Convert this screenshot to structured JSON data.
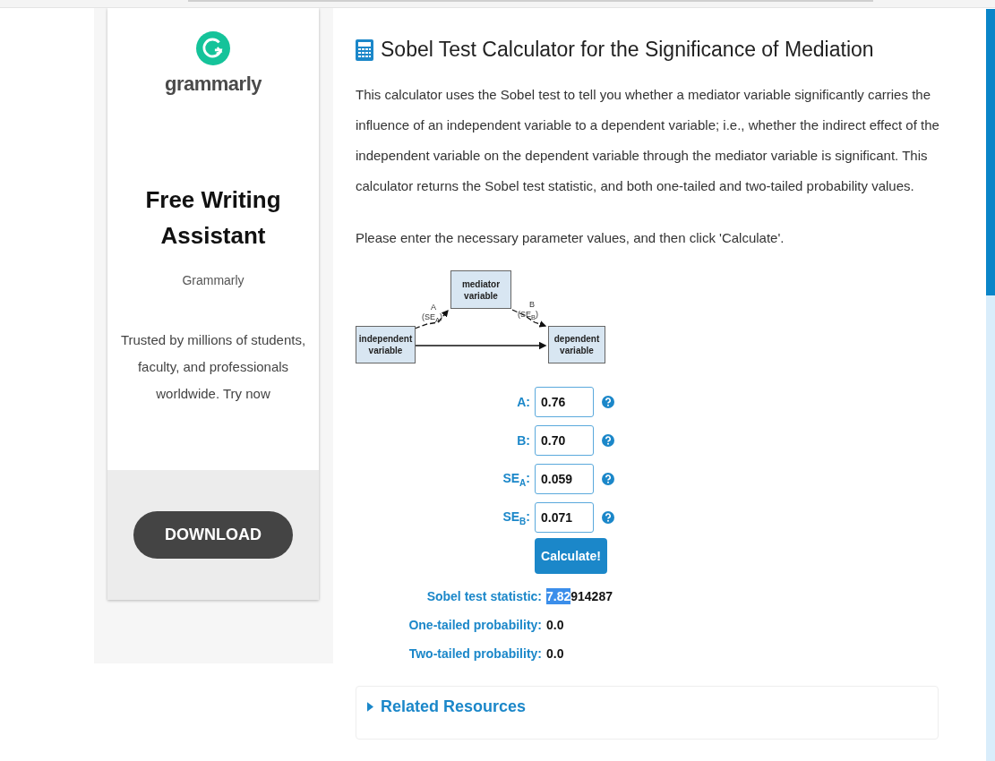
{
  "ad": {
    "logo_word": "grammarly",
    "headline": "Free Writing Assistant",
    "advertiser": "Grammarly",
    "description": "Trusted by millions of students, faculty, and professionals worldwide. Try now",
    "button": "DOWNLOAD"
  },
  "title": "Sobel Test Calculator for the Significance of Mediation",
  "intro": "This calculator uses the Sobel test to tell you whether a mediator variable significantly carries the influence of an independent variable to a dependent variable; i.e., whether the indirect effect of the independent variable on the dependent variable through the mediator variable is significant. This calculator returns the Sobel test statistic, and both one-tailed and two-tailed probability values.",
  "instruction": "Please enter the necessary parameter values, and then click 'Calculate'.",
  "diagram": {
    "mediator": "mediator variable",
    "independent": "independent variable",
    "dependent": "dependent variable",
    "path_a": "A",
    "path_a_se": "(SE$_{A}$)",
    "path_b": "B",
    "path_b_se": "(SE$_{B}$)"
  },
  "fields": [
    {
      "label": "A:",
      "value": "0.76"
    },
    {
      "label": "B:",
      "value": "0.70"
    },
    {
      "label": "SE$_{A}$:",
      "value": "0.059"
    },
    {
      "label": "SE$_{B}$:",
      "value": "0.071"
    }
  ],
  "calculate_button": "Calculate!",
  "results": [
    {
      "label": "Sobel test statistic:",
      "parts": [
        {
          "text": "7.82",
          "selected": true
        },
        {
          "text": "914287",
          "selected": false
        }
      ]
    },
    {
      "label": "One-tailed probability:",
      "parts": [
        {
          "text": "0.0",
          "selected": false
        }
      ]
    },
    {
      "label": "Two-tailed probability:",
      "parts": [
        {
          "text": "0.0",
          "selected": false
        }
      ]
    }
  ],
  "related": {
    "label": "Related Resources",
    "expanded": false
  }
}
